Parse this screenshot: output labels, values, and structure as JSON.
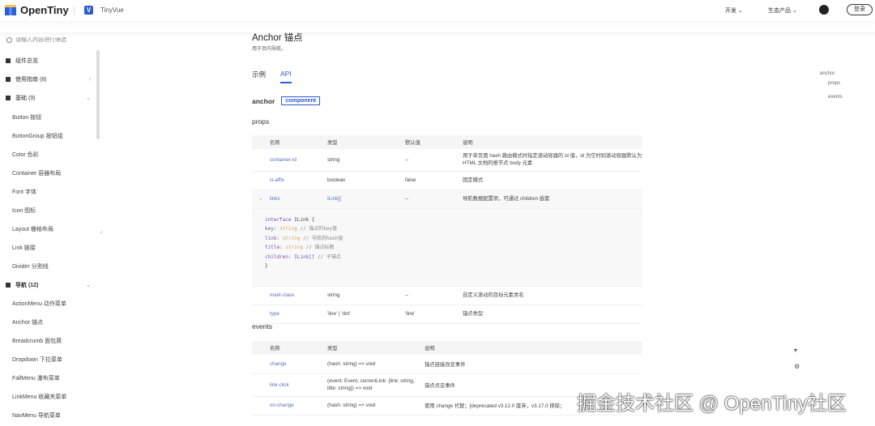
{
  "header": {
    "brand": "OpenTiny",
    "product": "TinyVue",
    "nav": [
      "开发",
      "生态产品"
    ],
    "login": "登录"
  },
  "sidebar": {
    "search_placeholder": "请输入内容进行筛选",
    "groups": [
      {
        "label": "组件总览"
      },
      {
        "label": "使用指南 (8)"
      },
      {
        "label": "基础 (9)"
      },
      {
        "label": "导航 (12)"
      }
    ],
    "basic_items": [
      "Button 按钮",
      "ButtonGroup 按钮组",
      "Color 色彩",
      "Container 容器布局",
      "Font 字体",
      "Icon 图标",
      "Layout 栅格布局",
      "Link 链接",
      "Divider 分割线"
    ],
    "nav_items": [
      "ActionMenu 动作菜单",
      "Anchor 锚点",
      "Breadcrumb 面包屑",
      "Dropdown 下拉菜单",
      "FallMenu 瀑布菜单",
      "LinkMenu 收藏夹菜单",
      "NavMenu 导航菜单"
    ]
  },
  "page": {
    "title": "Anchor 锚点",
    "desc": "用于页内导航。",
    "tabs": [
      "示例",
      "API"
    ],
    "component": "anchor",
    "badge": "component",
    "props_title": "props",
    "events_title": "events"
  },
  "props": {
    "headers": [
      "名称",
      "类型",
      "默认值",
      "说明"
    ],
    "rows": [
      [
        "container-id",
        "string",
        "--",
        "用于单页面 hash 路由模式时指定滚动容器的 id 值，id 为空时则滚动容器默认为 HTML 文档的根节点 body 元素"
      ],
      [
        "is-affix",
        "boolean",
        "false",
        "固定模式"
      ],
      [
        "links",
        "ILink[]",
        "--",
        "导航数据配置项，可通过 children 嵌套"
      ],
      [
        "mark-class",
        "string",
        "--",
        "自定义滚动的目标元素类名"
      ],
      [
        "type",
        "'line' | 'dot'",
        "'line'",
        "锚点类型"
      ]
    ]
  },
  "code": {
    "l0a": "interface",
    "l0b": " ILink {",
    "l1": [
      "  key: ",
      "string",
      " // 锚点的key值"
    ],
    "l2": [
      "  link: ",
      "string",
      " // 导航的hash值"
    ],
    "l3": [
      "  title: ",
      "string",
      " // 锚点标题"
    ],
    "l4": [
      "  children: ILink[]",
      "",
      " // 子锚点"
    ],
    "l5": "}"
  },
  "events": {
    "headers": [
      "名称",
      "类型",
      "说明"
    ],
    "rows": [
      [
        "change",
        "(hash: string) => void",
        "锚点链接改变事件"
      ],
      [
        "link-click",
        "(event: Event, currentLink: {link: string, title: string}) => void",
        "锚点点击事件"
      ],
      [
        "on-change",
        "(hash: string) => void",
        "使用 change 代替；[deprecated v3.12.0 废弃，v3.17.0 移除；"
      ]
    ]
  },
  "toc": [
    "anchor",
    "props",
    "events"
  ],
  "watermark": "掘金技术社区 @ OpenTiny社区"
}
